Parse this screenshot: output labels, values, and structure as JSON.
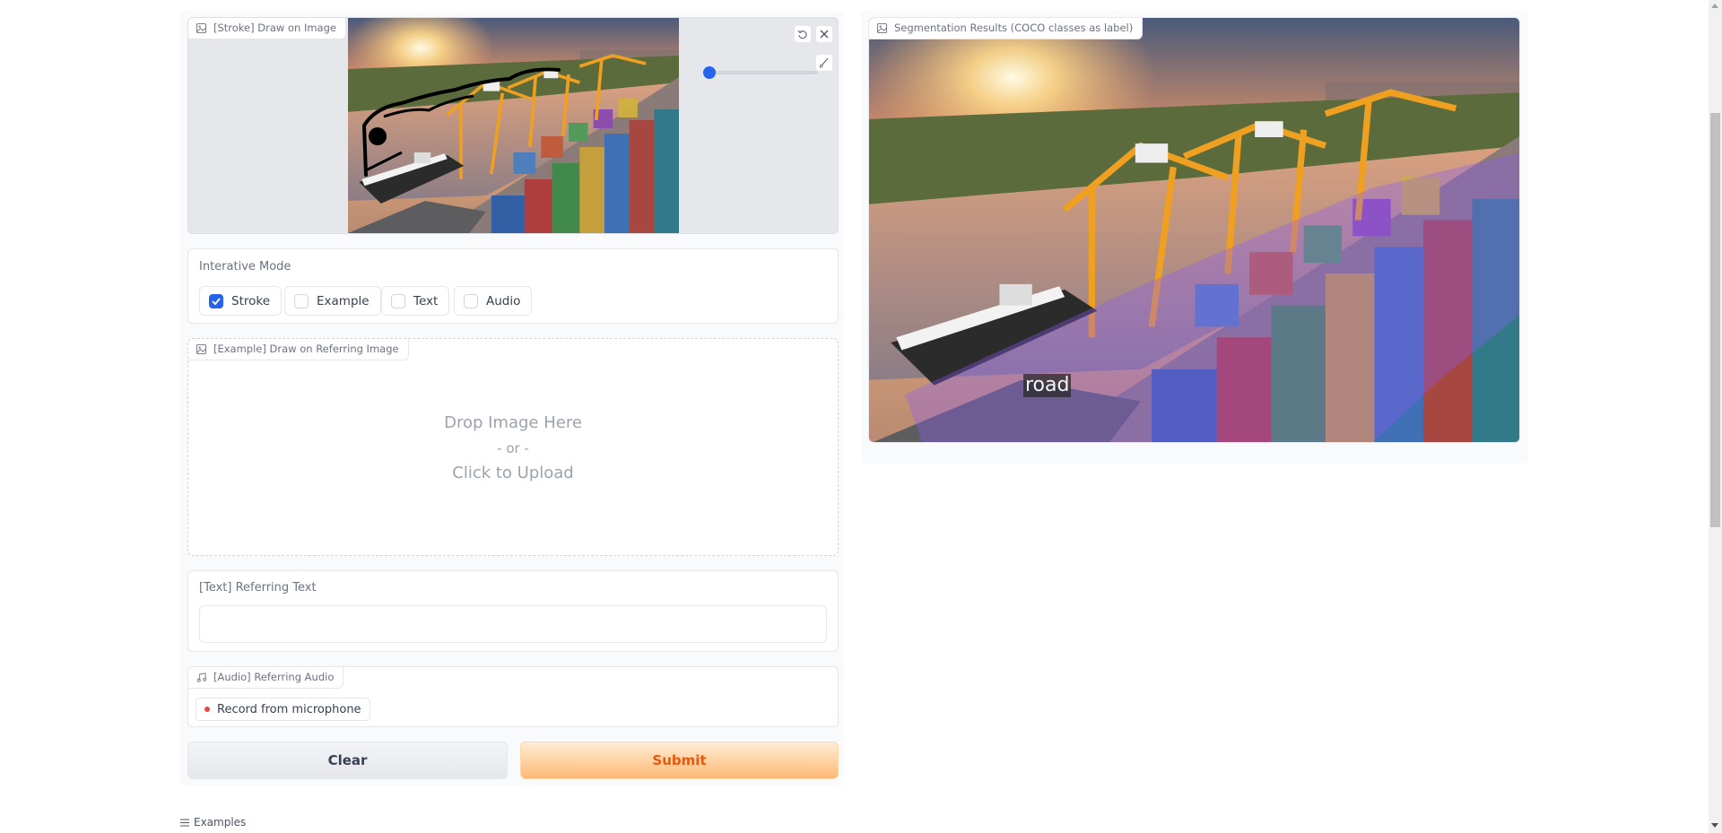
{
  "stroke_panel": {
    "label": "[Stroke] Draw on Image",
    "icons": {
      "image": "image-icon",
      "undo": "undo-icon",
      "clear": "close-icon",
      "brush": "brush-icon"
    },
    "brush_size": 0.0
  },
  "interactive_mode": {
    "label": "Interative Mode",
    "options": [
      {
        "label": "Stroke",
        "checked": true
      },
      {
        "label": "Example",
        "checked": false
      },
      {
        "label": "Text",
        "checked": false
      },
      {
        "label": "Audio",
        "checked": false
      }
    ]
  },
  "example_panel": {
    "label": "[Example] Draw on Referring Image",
    "drop_text": "Drop Image Here",
    "or_text": "- or -",
    "click_text": "Click to Upload"
  },
  "text_panel": {
    "label": "[Text] Referring Text",
    "value": ""
  },
  "audio_panel": {
    "label": "[Audio] Referring Audio",
    "record_label": "Record from microphone"
  },
  "actions": {
    "clear_label": "Clear",
    "submit_label": "Submit"
  },
  "result_panel": {
    "label": "Segmentation Results (COCO classes as label)",
    "mask_label": "road"
  },
  "examples": {
    "label": "Examples"
  },
  "colors": {
    "accent": "#2563eb",
    "submit_text": "#ea580c",
    "mask": "#8b5cf6"
  }
}
